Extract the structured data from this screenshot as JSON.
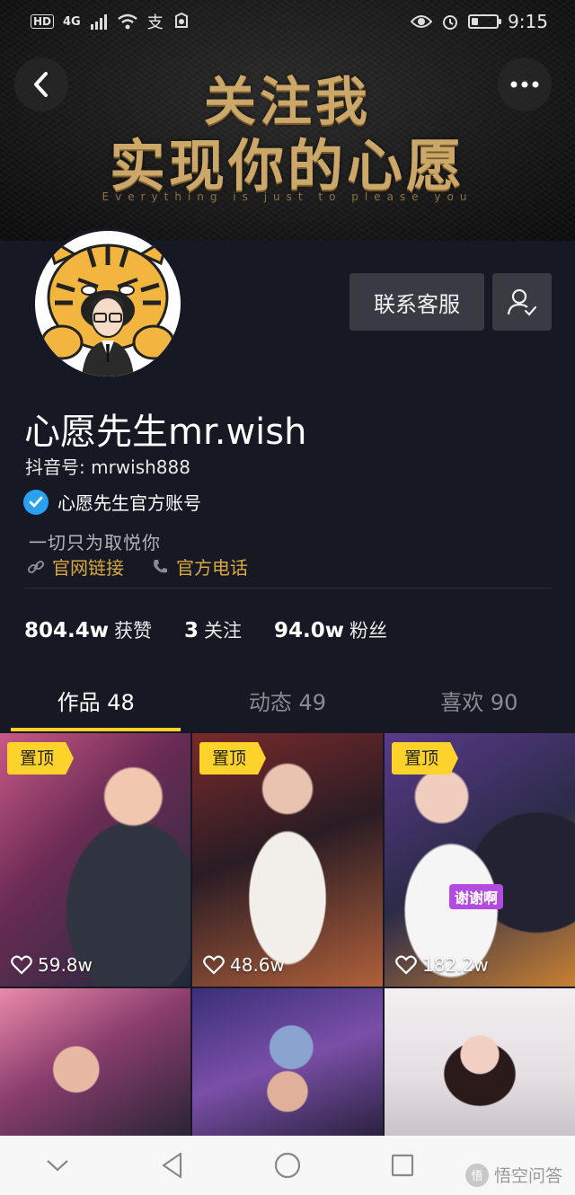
{
  "status_bar": {
    "hd": "HD",
    "network": "4G",
    "time": "9:15",
    "battery_level": 0.25
  },
  "banner": {
    "title_line1": "关注我",
    "title_line2": "实现你的心愿",
    "subtitle": "Everything is just to please you",
    "title_color": "#cba86a"
  },
  "profile": {
    "nickname": "心愿先生mr.wish",
    "douyin_id": "抖音号: mrwish888",
    "verified_text": "心愿先生官方账号",
    "bio": "一切只为取悦你",
    "links": [
      {
        "label": "官网链接",
        "icon": "link-icon"
      },
      {
        "label": "官方电话",
        "icon": "phone-icon"
      }
    ],
    "contact_button": "联系客服",
    "accent_color": "#d9a840"
  },
  "stats": [
    {
      "value": "804.4w",
      "label": "获赞"
    },
    {
      "value": "3",
      "label": "关注"
    },
    {
      "value": "94.0w",
      "label": "粉丝"
    }
  ],
  "tabs": [
    {
      "label": "作品 48",
      "active": true
    },
    {
      "label": "动态 49",
      "active": false
    },
    {
      "label": "喜欢 90",
      "active": false
    }
  ],
  "videos": [
    {
      "pinned": "置顶",
      "likes": "59.8w"
    },
    {
      "pinned": "置顶",
      "likes": "48.6w"
    },
    {
      "pinned": "置顶",
      "likes": "182.2w",
      "caption": "谢谢啊"
    },
    {},
    {},
    {}
  ],
  "watermark": "悟空问答",
  "colors": {
    "background": "#161823",
    "tab_indicator": "#fdd22a",
    "verified": "#2aa1f0"
  }
}
